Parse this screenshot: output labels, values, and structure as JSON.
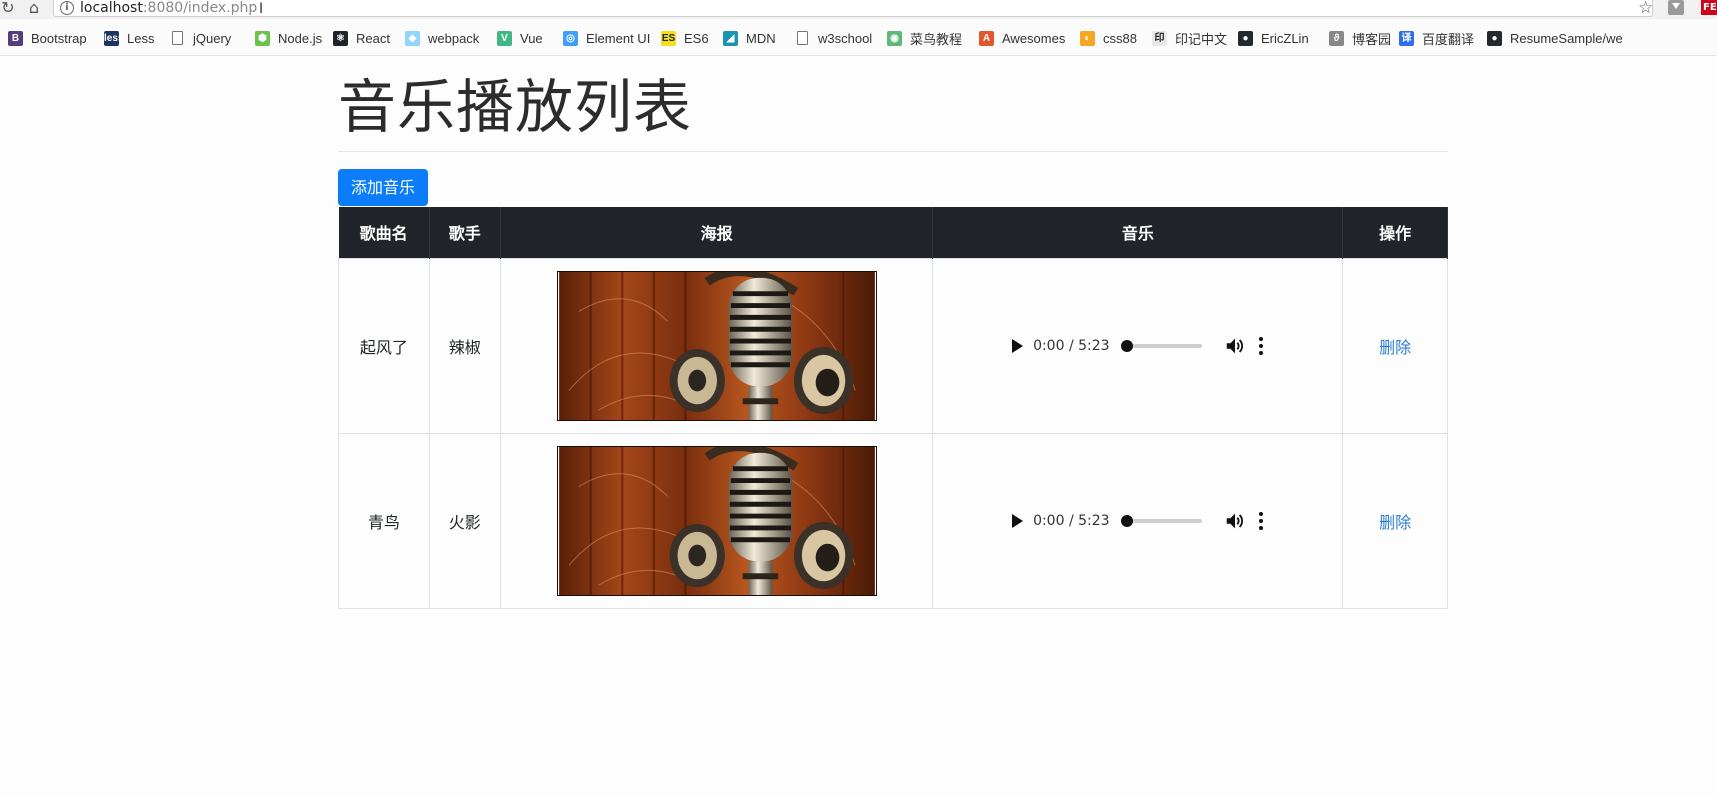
{
  "browser": {
    "url_host": "localhost",
    "url_rest": ":8080/index.php",
    "nav_reload_icon": "reload-icon",
    "nav_home_icon": "home-icon",
    "bookmarks": [
      {
        "label": "Bootstrap",
        "icon": "B",
        "color": "#563d7c"
      },
      {
        "label": "Less",
        "icon": "less",
        "color": "#1d365d"
      },
      {
        "label": "jQuery",
        "icon": "",
        "color": "file"
      },
      {
        "label": "Node.js",
        "icon": "⬢",
        "color": "#6cc24a"
      },
      {
        "label": "React",
        "icon": "⚛",
        "color": "#20232a"
      },
      {
        "label": "webpack",
        "icon": "◆",
        "color": "#8ed6fb"
      },
      {
        "label": "Vue",
        "icon": "V",
        "color": "#41b883"
      },
      {
        "label": "Element UI",
        "icon": "◎",
        "color": "#409eff"
      },
      {
        "label": "ES6",
        "icon": "ES",
        "color": "#f7df1e"
      },
      {
        "label": "MDN",
        "icon": "◢",
        "color": "#1a94b0"
      },
      {
        "label": "w3school",
        "icon": "",
        "color": "file"
      },
      {
        "label": "菜鸟教程",
        "icon": "◉",
        "color": "#5fb878"
      },
      {
        "label": "Awesomes",
        "icon": "A",
        "color": "#e4572e"
      },
      {
        "label": "css88",
        "icon": "◐",
        "color": "#f5a623"
      },
      {
        "label": "印记中文",
        "icon": "印",
        "color": "#e8e8e8"
      },
      {
        "label": "EricZLin",
        "icon": "●",
        "color": "#24292e"
      },
      {
        "label": "博客园",
        "icon": "ϑ",
        "color": "#888888"
      },
      {
        "label": "百度翻译",
        "icon": "译",
        "color": "#2e6fe9"
      },
      {
        "label": "ResumeSample/we",
        "icon": "●",
        "color": "#24292e"
      }
    ]
  },
  "page": {
    "title": "音乐播放列表",
    "add_button": "添加音乐"
  },
  "table": {
    "headers": [
      "歌曲名",
      "歌手",
      "海报",
      "音乐",
      "操作"
    ],
    "rows": [
      {
        "name": "起风了",
        "singer": "辣椒",
        "time": "0:00 / 5:23",
        "progress": 0,
        "action": "删除"
      },
      {
        "name": "青鸟",
        "singer": "火影",
        "time": "0:00 / 5:23",
        "progress": 0,
        "action": "删除"
      }
    ]
  },
  "colors": {
    "accent": "#0b7dfb",
    "header_bg": "#212529",
    "link": "#2a7ed2"
  }
}
